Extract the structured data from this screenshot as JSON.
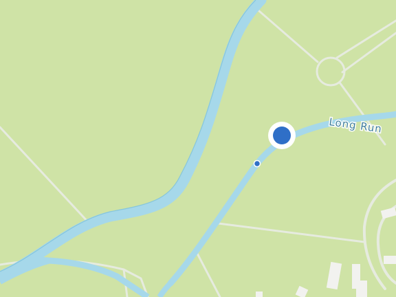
{
  "map": {
    "water_label": "Long Run",
    "colors": {
      "land": "#cfe3a6",
      "park": "#c6e09d",
      "water": "#a6d8ea",
      "water_outline": "#86c6dc",
      "road": "#e6ebdf",
      "building": "#f2f2ef",
      "location_dot": "#2f6fc7",
      "location_halo": "#ffffff"
    },
    "markers": [
      {
        "name": "current-location",
        "kind": "user-location-dot"
      },
      {
        "name": "small-point",
        "kind": "point-marker"
      }
    ]
  }
}
